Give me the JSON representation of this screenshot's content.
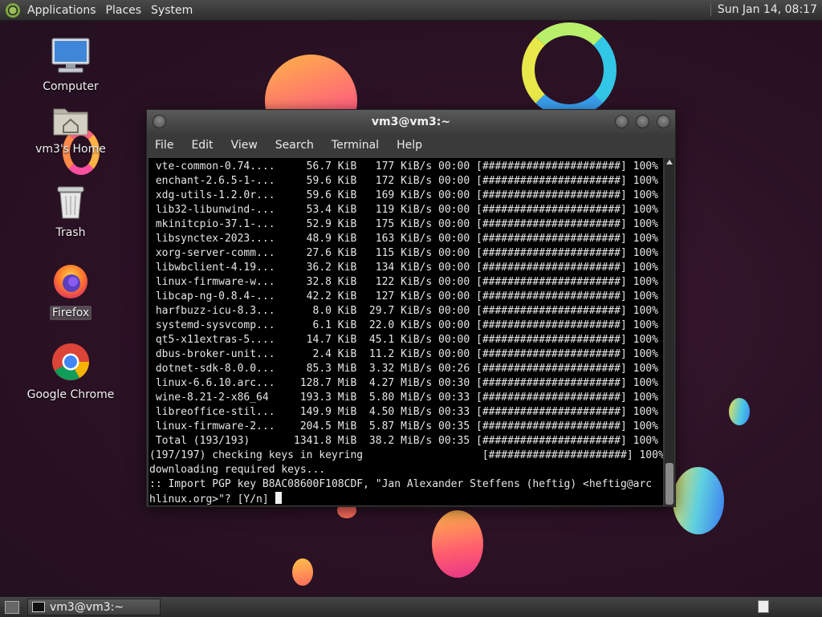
{
  "top_panel": {
    "menus": [
      "Applications",
      "Places",
      "System"
    ],
    "clock": "Sun Jan 14, 08:17"
  },
  "desktop_icons": [
    {
      "label": "Computer",
      "icon": "computer-icon"
    },
    {
      "label": "vm3's Home",
      "icon": "home-folder-icon"
    },
    {
      "label": "Trash",
      "icon": "trash-icon"
    },
    {
      "label": "Firefox",
      "icon": "firefox-icon"
    },
    {
      "label": "Google Chrome",
      "icon": "chrome-icon"
    }
  ],
  "window": {
    "title": "vm3@vm3:~",
    "menus": [
      "File",
      "Edit",
      "View",
      "Search",
      "Terminal",
      "Help"
    ]
  },
  "terminal": {
    "lines": [
      " vte-common-0.74....     56.7 KiB   177 KiB/s 00:00 [######################] 100%",
      " enchant-2.6.5-1-...     59.6 KiB   172 KiB/s 00:00 [######################] 100%",
      " xdg-utils-1.2.0r...     59.6 KiB   169 KiB/s 00:00 [######################] 100%",
      " lib32-libunwind-...     53.4 KiB   119 KiB/s 00:00 [######################] 100%",
      " mkinitcpio-37.1-...     52.9 KiB   175 KiB/s 00:00 [######################] 100%",
      " libsynctex-2023....     48.9 KiB   163 KiB/s 00:00 [######################] 100%",
      " xorg-server-comm...     27.6 KiB   115 KiB/s 00:00 [######################] 100%",
      " libwbclient-4.19...     36.2 KiB   134 KiB/s 00:00 [######################] 100%",
      " linux-firmware-w...     32.8 KiB   122 KiB/s 00:00 [######################] 100%",
      " libcap-ng-0.8.4-...     42.2 KiB   127 KiB/s 00:00 [######################] 100%",
      " harfbuzz-icu-8.3...      8.0 KiB  29.7 KiB/s 00:00 [######################] 100%",
      " systemd-sysvcomp...      6.1 KiB  22.0 KiB/s 00:00 [######################] 100%",
      " qt5-x11extras-5....     14.7 KiB  45.1 KiB/s 00:00 [######################] 100%",
      " dbus-broker-unit...      2.4 KiB  11.2 KiB/s 00:00 [######################] 100%",
      " dotnet-sdk-8.0.0...     85.3 MiB  3.32 MiB/s 00:26 [######################] 100%",
      " linux-6.6.10.arc...    128.7 MiB  4.27 MiB/s 00:30 [######################] 100%",
      " wine-8.21-2-x86_64     193.3 MiB  5.80 MiB/s 00:33 [######################] 100%",
      " libreoffice-stil...    149.9 MiB  4.50 MiB/s 00:33 [######################] 100%",
      " linux-firmware-2...    204.5 MiB  5.87 MiB/s 00:35 [######################] 100%",
      " Total (193/193)       1341.8 MiB  38.2 MiB/s 00:35 [######################] 100%",
      "(197/197) checking keys in keyring                   [######################] 100%",
      "downloading required keys...",
      ":: Import PGP key B8AC08600F108CDF, \"Jan Alexander Steffens (heftig) <heftig@arc",
      "hlinux.org>\"? [Y/n] "
    ]
  },
  "taskbar": {
    "task_label": "vm3@vm3:~"
  }
}
